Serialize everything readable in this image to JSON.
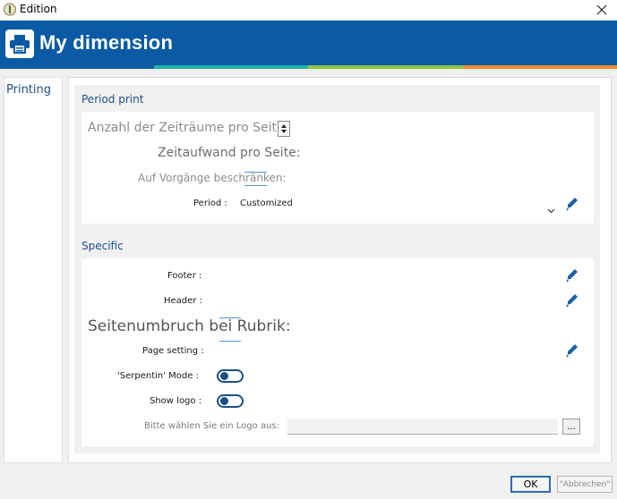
{
  "window": {
    "title": "Edition",
    "close_icon": "close-icon"
  },
  "banner": {
    "title": "My dimension",
    "icon": "printer-icon",
    "stripe_colors": [
      "#0a5aa6",
      "#1fb3a6",
      "#8cc63f",
      "#f08a24"
    ]
  },
  "sidebar": {
    "items": [
      {
        "label": "Printing"
      }
    ]
  },
  "period_print": {
    "title": "Period print",
    "periods_per_page_label": "Anzahl der Zeiträume pro Seite:",
    "time_per_page_label": "Zeitaufwand pro Seite:",
    "restrict_label": "Auf Vorgänge beschränken:",
    "period_label": "Period :",
    "period_value": "Customized"
  },
  "specific": {
    "title": "Specific",
    "footer_label": "Footer :",
    "header_label": "Header :",
    "page_break_label": "Seitenumbruch bei Rubrik:",
    "page_setting_label": "Page setting :",
    "serpentin_label": "'Serpentin' Mode :",
    "show_logo_label": "Show logo :",
    "logo_select_label": "Bitte wählen Sie ein Logo aus:",
    "browse_label": "..."
  },
  "footer": {
    "ok_label": "OK",
    "cancel_label": "\"Abbrechen\""
  }
}
